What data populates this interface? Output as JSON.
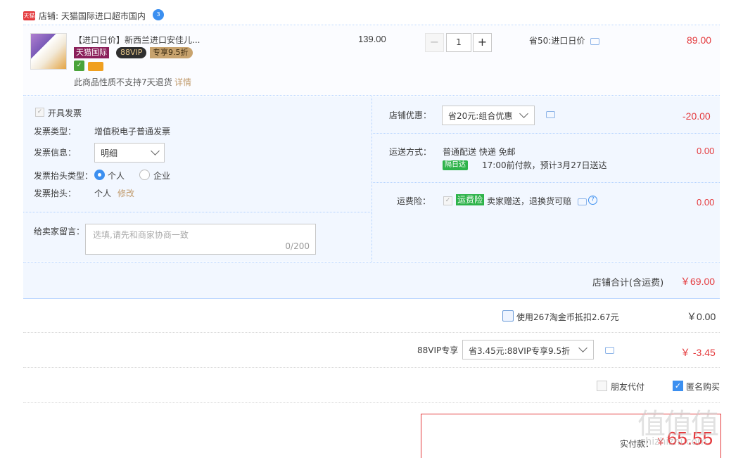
{
  "shop": {
    "logo_text": "天猫",
    "label": "店铺: 天猫国际进口超市国内",
    "chat_badge": "3"
  },
  "item": {
    "title": "【进口日价】新西兰进口安佳儿...",
    "badge_intl": "天猫国际",
    "badge_88vip": "88VIP",
    "badge_vip_discount": "专享9.5折",
    "return_note": "此商品性质不支持7天退货",
    "return_detail": "详情",
    "price": "139.00",
    "quantity": "1",
    "qty_minus": "−",
    "qty_plus": "+",
    "promo": "省50:进口日价",
    "subtotal": "89.00"
  },
  "invoice": {
    "checkbox_label": "开具发票",
    "type_label": "发票类型：",
    "type_value": "增值税电子普通发票",
    "info_label": "发票信息：",
    "info_value": "明细",
    "title_type_label": "发票抬头类型：",
    "option_personal": "个人",
    "option_company": "企业",
    "title_label": "发票抬头：",
    "title_value": "个人",
    "title_edit": "修改"
  },
  "message": {
    "label": "给卖家留言：",
    "placeholder": "选填,请先和商家协商一致",
    "counter": "0/200"
  },
  "shop_discount": {
    "label": "店铺优惠：",
    "value": "省20元:组合优惠",
    "amount": "-20.00"
  },
  "shipping": {
    "label": "运送方式：",
    "value": "普通配送 快递 免邮",
    "badge": "隔日达",
    "eta": "17:00前付款，预计3月27日送达",
    "cost": "0.00"
  },
  "insurance": {
    "label": "运费险：",
    "badge": "运费险",
    "desc": "卖家赠送，退换货可赔",
    "help": "?",
    "cost": "0.00"
  },
  "shop_total": {
    "label": "店铺合计(含运费)",
    "value": "￥69.00"
  },
  "coins": {
    "label": "使用267淘金币抵扣2.67元",
    "value": "￥0.00"
  },
  "vip": {
    "label": "88VIP专享",
    "select_value": "省3.45元:88VIP专享9.5折",
    "value": "￥ -3.45"
  },
  "options": {
    "friend_pay": "朋友代付",
    "anonymous": "匿名购买"
  },
  "payment": {
    "label": "实付款：",
    "currency": "￥",
    "amount": "65.55"
  },
  "watermark": {
    "main": "值值值",
    "sub": "zhizhizhi.com"
  },
  "colors": {
    "accent_red": "#e4393c",
    "accent_blue": "#3b8ff0",
    "panel_bg": "#f2f7ff",
    "green_badge": "#2eb34a"
  }
}
